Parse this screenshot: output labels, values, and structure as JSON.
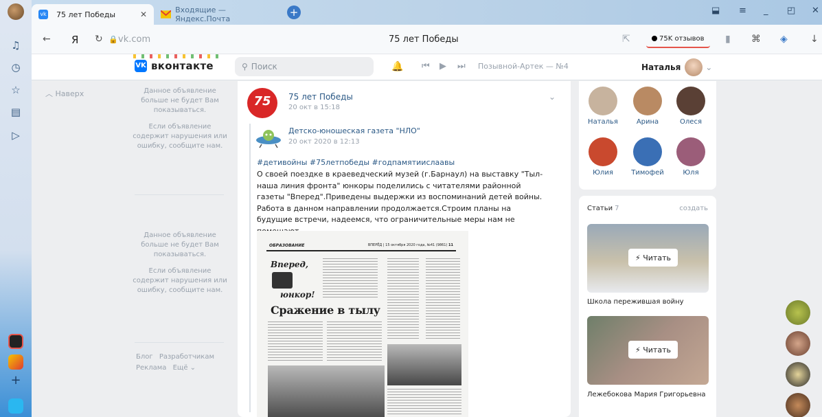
{
  "browser": {
    "tabs": [
      {
        "label": "75 лет Победы",
        "active": true
      },
      {
        "label": "Входящие — Яндекс.Почта",
        "active": false
      }
    ],
    "url": "vk.com",
    "page_title": "75 лет Победы",
    "reviews": "75K отзывов",
    "ya_letter": "Я"
  },
  "vk": {
    "logo_text": "вконтакте",
    "logo_mark": "VK",
    "search_placeholder": "Поиск",
    "track": "Позывной-Артек — №4",
    "user_name": "Наталья"
  },
  "left": {
    "up_link": "Наверх",
    "ads": [
      {
        "p1": "Данное объявление больше не будет Вам показываться.",
        "p2": "Если объявление содержит нарушения или ошибку, сообщите нам."
      },
      {
        "p1": "Данное объявление больше не будет Вам показываться.",
        "p2": "Если объявление содержит нарушения или ошибку, сообщите нам."
      }
    ],
    "footer": [
      "Блог",
      "Разработчикам",
      "Реклама",
      "Ещё ⌄"
    ]
  },
  "post": {
    "author": "75 лет Победы",
    "avatar_text": "75",
    "date": "20 окт в 15:18",
    "repost_author": "Детско-юношеская газета \"НЛО\"",
    "repost_date": "20 окт 2020 в 12:13",
    "hashtags": "#детивойны #75летпобеды #годпамятиислаавы",
    "text": "О своей поездке в краеведческий музей (г.Барнаул) на выставку \"Тыл-наша линия фронта\" юнкоры поделились с читателями районной газеты \"Вперед\".Приведены выдержки из воспоминаний детей войны. Работа в данном направлении продолжается.Строим планы на будущие встречи, надеемся, что ограничительные меры нам не помешают.",
    "newspaper": {
      "section": "ОБРАЗОВАНИЕ",
      "issue": "ВПЕРЁД | 15 октября 2020 года, №41 (9861)",
      "page": "11",
      "headline_1": "Вперед,",
      "headline_2": "юнкор!",
      "title": "Сражение в тылу"
    }
  },
  "friends": [
    {
      "name": "Наталья",
      "color": "#c7b39e"
    },
    {
      "name": "Арина",
      "color": "#b98a63"
    },
    {
      "name": "Олеся",
      "color": "#5a4035"
    },
    {
      "name": "Юлия",
      "color": "#c9492e"
    },
    {
      "name": "Тимофей",
      "color": "#3a6fb5"
    },
    {
      "name": "Юля",
      "color": "#9b5d79"
    }
  ],
  "articles": {
    "title": "Статьи",
    "count": "7",
    "create": "создать",
    "read_label": "⚡ Читать",
    "items": [
      {
        "title": "Школа пережившая войну"
      },
      {
        "title": "Лежебокова Мария Григорьевна"
      }
    ]
  }
}
